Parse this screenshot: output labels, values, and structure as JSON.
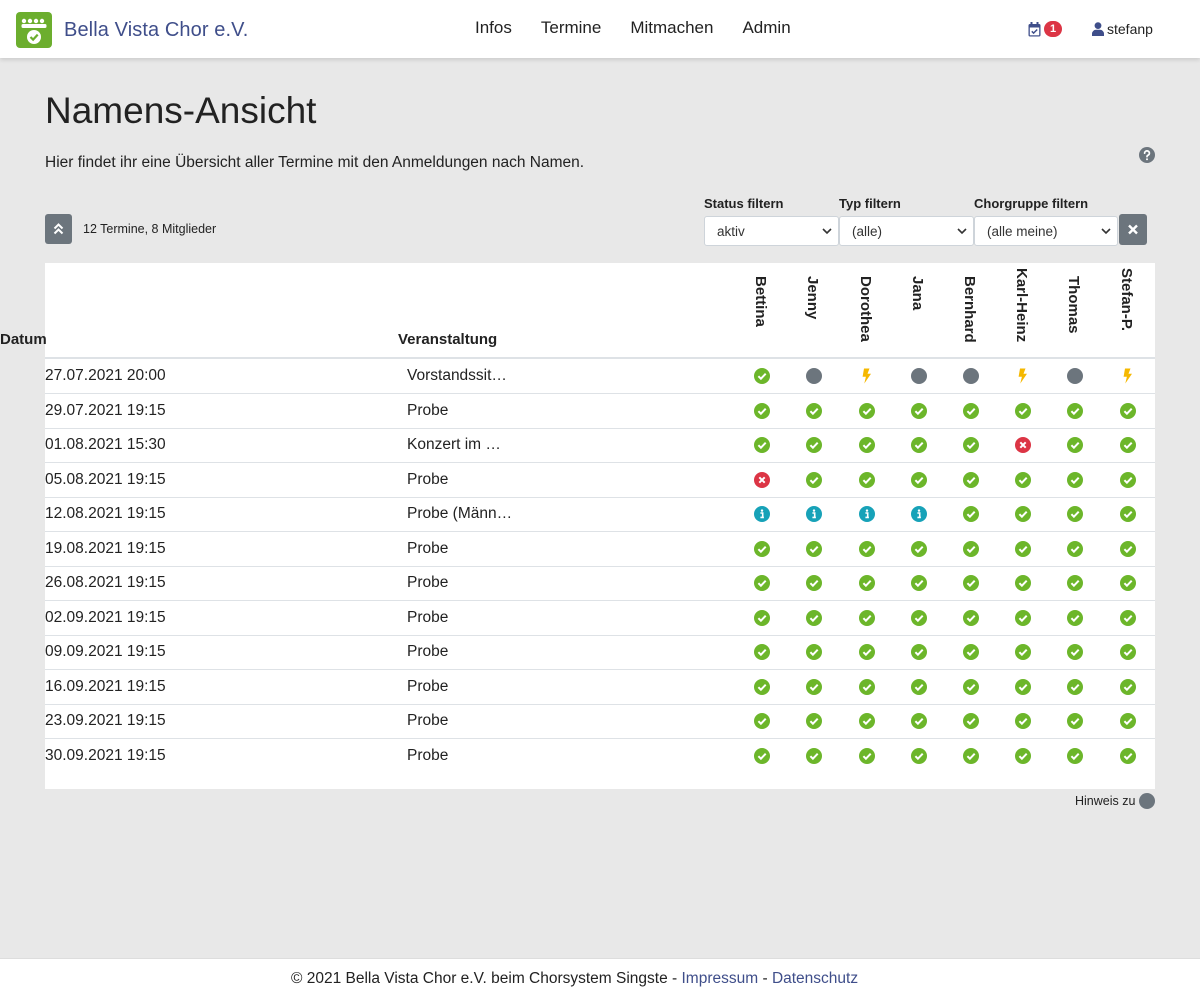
{
  "navbar": {
    "brand": "Bella Vista Chor e.V.",
    "links": [
      "Infos",
      "Termine",
      "Mitmachen",
      "Admin"
    ],
    "notification_count": "1",
    "username": "stefanp"
  },
  "page": {
    "title": "Namens-Ansicht",
    "intro": "Hier findet ihr eine Übersicht aller Termine mit den Anmeldungen nach Namen.",
    "summary": "12 Termine, 8 Mitglieder"
  },
  "filters": [
    {
      "label": "Status filtern",
      "value": "aktiv"
    },
    {
      "label": "Typ filtern",
      "value": "(alle)"
    },
    {
      "label": "Chorgruppe filtern",
      "value": "(alle meine)"
    }
  ],
  "table": {
    "col_date": "Datum",
    "col_event": "Veranstaltung",
    "members": [
      "Bettina",
      "Jenny",
      "Dorothea",
      "Jana",
      "Bernhard",
      "Karl-Heinz",
      "Thomas",
      "Stefan-P."
    ],
    "rows": [
      {
        "date": "27.07.2021 20:00",
        "event": "Vorstandssit…",
        "status": [
          "yes",
          "none",
          "bolt",
          "none",
          "none",
          "bolt",
          "none",
          "bolt"
        ]
      },
      {
        "date": "29.07.2021 19:15",
        "event": "Probe",
        "status": [
          "yes",
          "yes",
          "yes",
          "yes",
          "yes",
          "yes",
          "yes",
          "yes"
        ]
      },
      {
        "date": "01.08.2021 15:30",
        "event": "Konzert im …",
        "status": [
          "yes",
          "yes",
          "yes",
          "yes",
          "yes",
          "no",
          "yes",
          "yes"
        ]
      },
      {
        "date": "05.08.2021 19:15",
        "event": "Probe",
        "status": [
          "no",
          "yes",
          "yes",
          "yes",
          "yes",
          "yes",
          "yes",
          "yes"
        ]
      },
      {
        "date": "12.08.2021 19:15",
        "event": "Probe (Männ…",
        "status": [
          "info",
          "info",
          "info",
          "info",
          "yes",
          "yes",
          "yes",
          "yes"
        ]
      },
      {
        "date": "19.08.2021 19:15",
        "event": "Probe",
        "status": [
          "yes",
          "yes",
          "yes",
          "yes",
          "yes",
          "yes",
          "yes",
          "yes"
        ]
      },
      {
        "date": "26.08.2021 19:15",
        "event": "Probe",
        "status": [
          "yes",
          "yes",
          "yes",
          "yes",
          "yes",
          "yes",
          "yes",
          "yes"
        ]
      },
      {
        "date": "02.09.2021 19:15",
        "event": "Probe",
        "status": [
          "yes",
          "yes",
          "yes",
          "yes",
          "yes",
          "yes",
          "yes",
          "yes"
        ]
      },
      {
        "date": "09.09.2021 19:15",
        "event": "Probe",
        "status": [
          "yes",
          "yes",
          "yes",
          "yes",
          "yes",
          "yes",
          "yes",
          "yes"
        ]
      },
      {
        "date": "16.09.2021 19:15",
        "event": "Probe",
        "status": [
          "yes",
          "yes",
          "yes",
          "yes",
          "yes",
          "yes",
          "yes",
          "yes"
        ]
      },
      {
        "date": "23.09.2021 19:15",
        "event": "Probe",
        "status": [
          "yes",
          "yes",
          "yes",
          "yes",
          "yes",
          "yes",
          "yes",
          "yes"
        ]
      },
      {
        "date": "30.09.2021 19:15",
        "event": "Probe",
        "status": [
          "yes",
          "yes",
          "yes",
          "yes",
          "yes",
          "yes",
          "yes",
          "yes"
        ]
      }
    ]
  },
  "hint": "Hinweis zu",
  "footer": {
    "text": "© 2021 Bella Vista Chor e.V. beim Chorsystem Singste - ",
    "impressum": "Impressum",
    "separator": " - ",
    "datenschutz": "Datenschutz"
  },
  "colors": {
    "yes": "#6cb62a",
    "no": "#dc3545",
    "info": "#17a2b8",
    "bolt": "#f5b800",
    "none": "#6c757d",
    "brand": "#3f4e8a"
  }
}
